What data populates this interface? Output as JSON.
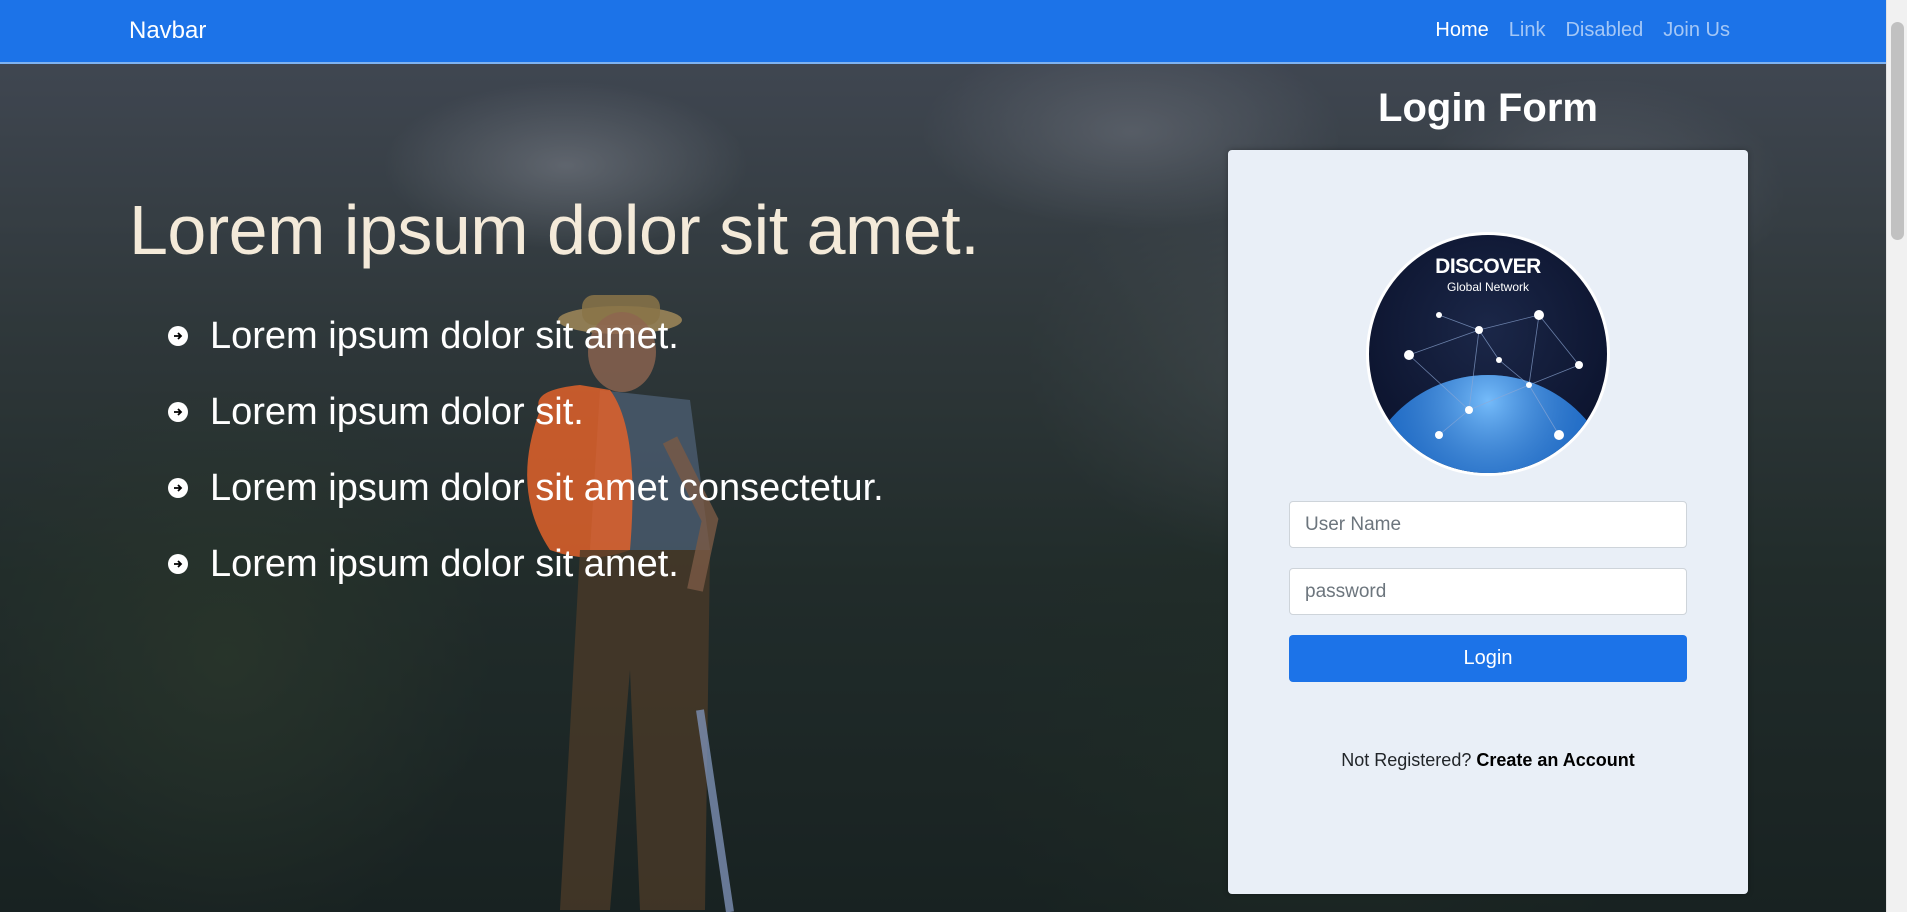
{
  "navbar": {
    "brand": "Navbar",
    "links": [
      {
        "label": "Home",
        "active": true
      },
      {
        "label": "Link",
        "active": false
      },
      {
        "label": "Disabled",
        "active": false
      },
      {
        "label": "Join Us",
        "active": false
      }
    ]
  },
  "hero": {
    "title_bold": "Lorem",
    "title_rest": " ipsum dolor sit amet.",
    "items": [
      "Lorem ipsum dolor sit amet.",
      "Lorem ipsum dolor sit.",
      "Lorem ipsum dolor sit amet consectetur.",
      "Lorem ipsum dolor sit amet."
    ]
  },
  "login": {
    "heading": "Login Form",
    "logo_wordmark": "DISCOVER",
    "logo_tagline": "Global Network",
    "username_placeholder": "User Name",
    "password_placeholder": "password",
    "login_label": "Login",
    "register_prompt": "Not Registered? ",
    "register_link": "Create an Account"
  },
  "colors": {
    "navbar": "#1c73e8",
    "card": "#e9eff7",
    "accent_orange": "#f47a20"
  }
}
